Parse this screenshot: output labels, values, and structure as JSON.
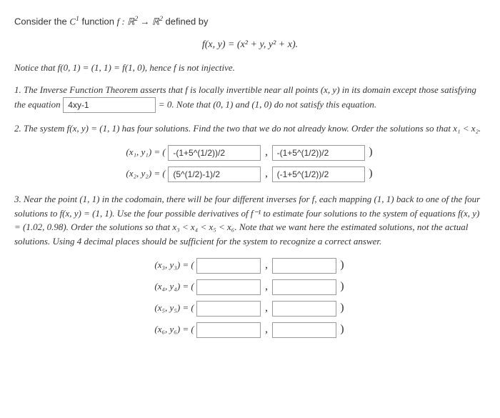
{
  "intro": {
    "line1_pre": "Consider the ",
    "line1_c1": "C",
    "line1_sup": "1",
    "line1_mid": " function ",
    "line1_f": "f : ℝ",
    "line1_sup2": "2",
    "line1_arrow": " → ℝ",
    "line1_sup3": "2",
    "line1_post": " defined by"
  },
  "eq1": "f(x, y) = (x² + y, y² + x).",
  "notice": "Notice that f(0, 1) = (1, 1) = f(1, 0), hence f is not injective.",
  "q1": {
    "pre": "1. The Inverse Function Theorem asserts that f is locally invertible near all points (x, y) in its domain except those satisfying the equation",
    "input_val": "4xy-1",
    "post": "= 0. Note that (0, 1) and (1, 0) do not satisfy this equation."
  },
  "q2": {
    "text": "2. The system f(x, y) = (1, 1) has four solutions. Find the two that we do not already know. Order the solutions so that x₁ < x₂.",
    "row1_label": "(x₁, y₁) = (",
    "row1_v1": "-(1+5^(1/2))/2",
    "row1_v2": "-(1+5^(1/2))/2",
    "row2_label": "(x₂, y₂) = (",
    "row2_v1": "(5^(1/2)-1)/2",
    "row2_v2": "(-1+5^(1/2))/2"
  },
  "q3": {
    "text": "3. Near the point (1, 1) in the codomain, there will be four different inverses for f, each mapping (1, 1) back to one of the four solutions to f(x, y) = (1, 1). Use the four possible derivatives of f⁻¹ to estimate four solutions to the system of equations f(x, y) = (1.02, 0.98). Order the solutions so that x₃ < x₄ < x₅ < x₆. Note that we want here the estimated solutions, not the actual solutions. Using 4 decimal places should be sufficient for the system to recognize a correct answer.",
    "rows": [
      {
        "label": "(x₃, y₃) = (",
        "v1": "",
        "v2": ""
      },
      {
        "label": "(x₄, y₄) = (",
        "v1": "",
        "v2": ""
      },
      {
        "label": "(x₅, y₅) = (",
        "v1": "",
        "v2": ""
      },
      {
        "label": "(x₆, y₆) = (",
        "v1": "",
        "v2": ""
      }
    ]
  },
  "comma": ",",
  "close_paren": ")"
}
